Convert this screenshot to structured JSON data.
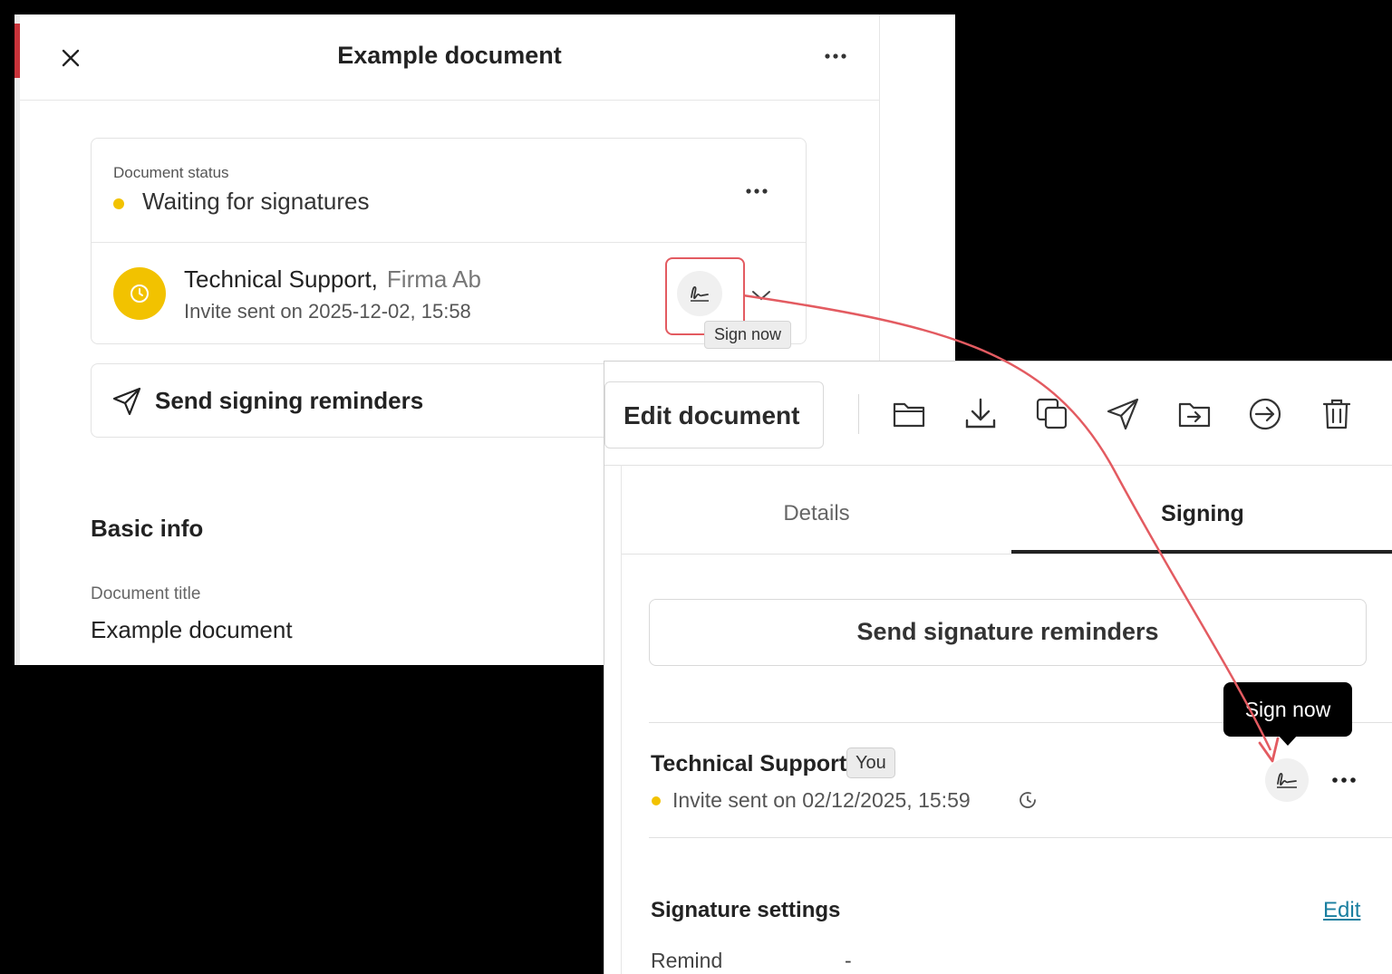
{
  "panel1": {
    "title": "Example document",
    "close_icon": "close-icon",
    "status_card": {
      "label": "Document status",
      "status": "Waiting for signatures",
      "status_color": "#f2c200"
    },
    "signer": {
      "name": "Technical Support,",
      "company": "Firma Ab",
      "invite": "Invite sent on 2025-12-02, 15:58",
      "avatar_color": "#f2c200",
      "sign_tooltip": "Sign now"
    },
    "reminder_button": "Send signing reminders",
    "basic_info": {
      "heading": "Basic info",
      "doc_title_label": "Document title",
      "doc_title_value": "Example document"
    }
  },
  "panel2": {
    "toolbar": {
      "edit_label": "Edit document",
      "icons": [
        "folder-icon",
        "download-icon",
        "copy-icon",
        "send-icon",
        "move-folder-icon",
        "export-icon",
        "trash-icon"
      ]
    },
    "tabs": [
      {
        "label": "Details",
        "active": false
      },
      {
        "label": "Signing",
        "active": true
      }
    ],
    "send_reminders": "Send signature reminders",
    "tooltip": "Sign now",
    "signer": {
      "name": "Technical Support",
      "badge": "You",
      "invite": "Invite sent on 02/12/2025, 15:59"
    },
    "signature_settings": {
      "heading": "Signature settings",
      "edit": "Edit",
      "remind_label": "Remind",
      "remind_value": "-"
    }
  },
  "colors": {
    "annotation": "#e35b61",
    "link": "#1a7fa0",
    "pending": "#f2c200"
  }
}
